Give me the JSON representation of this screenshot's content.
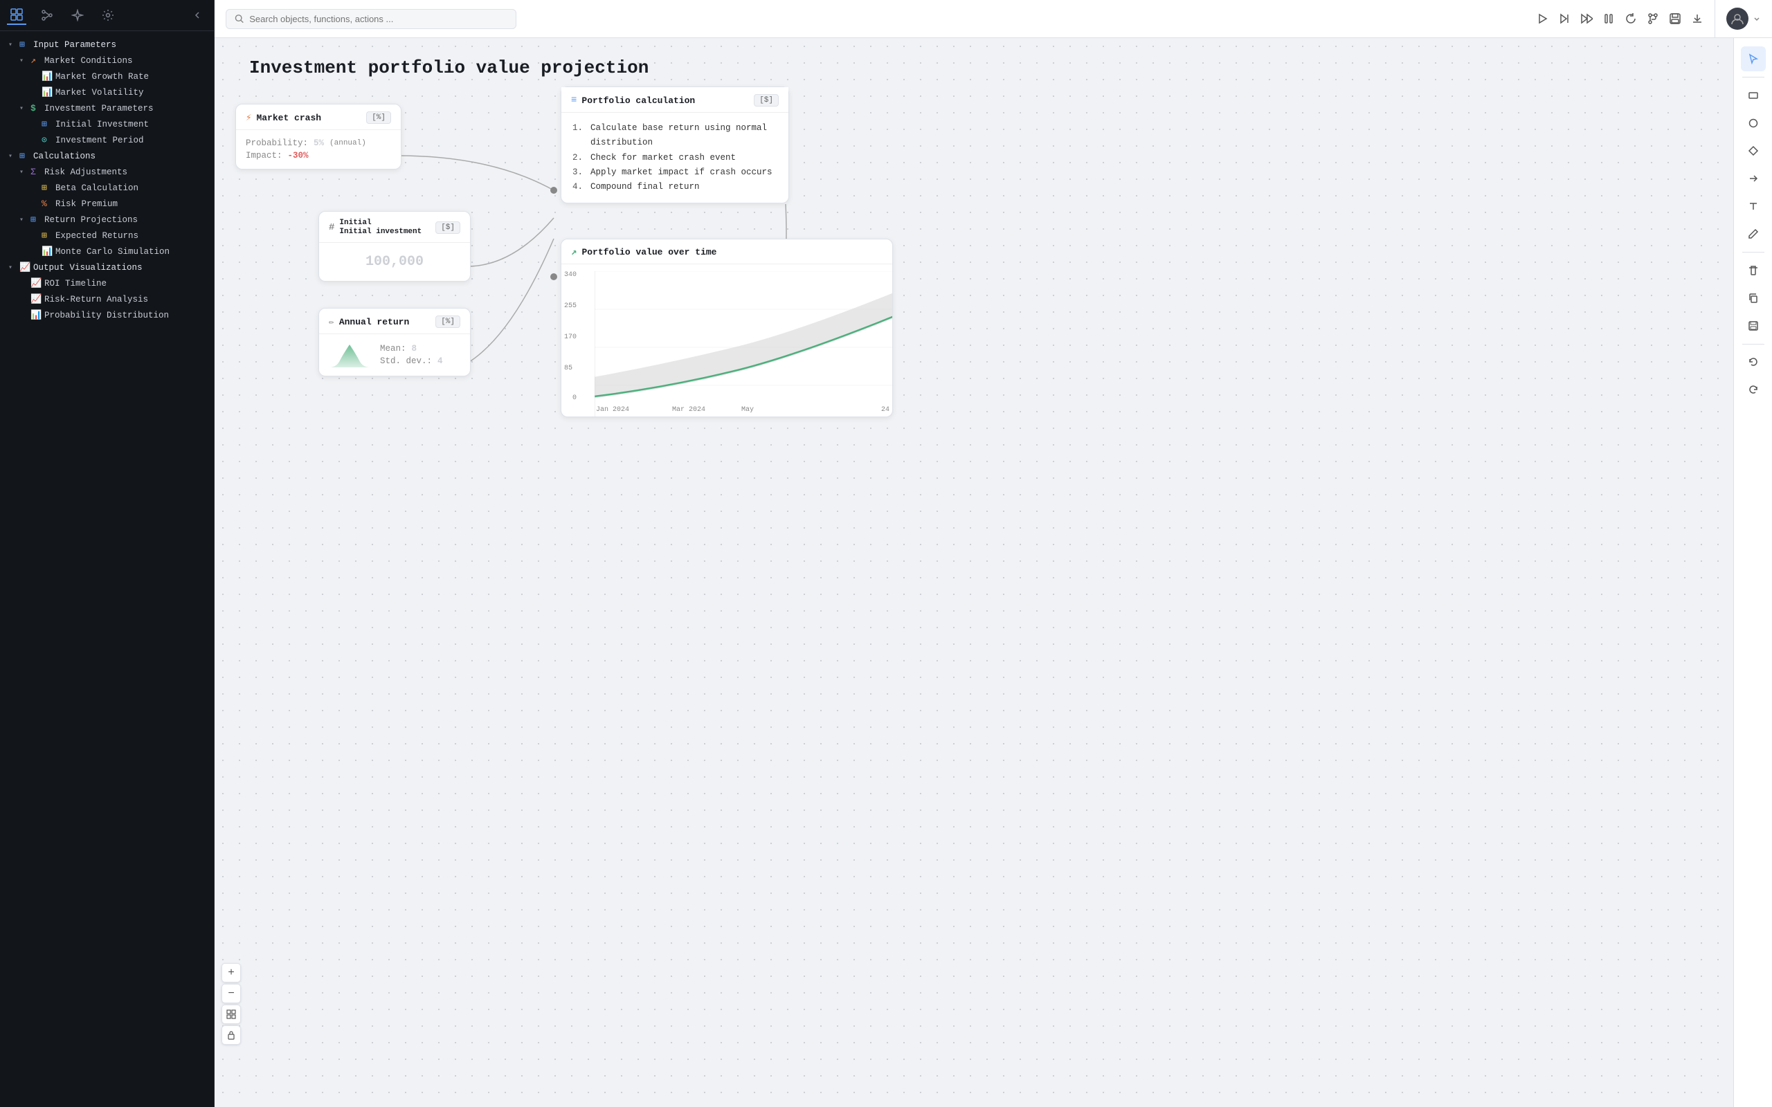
{
  "sidebar": {
    "top_icons": [
      "grid-icon",
      "git-icon",
      "sparkle-icon",
      "settings-icon"
    ],
    "tree": [
      {
        "id": "input-params",
        "label": "Input Parameters",
        "depth": 0,
        "icon": "⊞",
        "icon_color": "icon-blue",
        "expanded": true,
        "chevron": "▾"
      },
      {
        "id": "market-conditions",
        "label": "Market Conditions",
        "depth": 1,
        "icon": "↗",
        "icon_color": "icon-orange",
        "expanded": true,
        "chevron": "▾"
      },
      {
        "id": "market-growth-rate",
        "label": "Market Growth Rate",
        "depth": 2,
        "icon": "📊",
        "icon_color": "icon-red",
        "expanded": false,
        "chevron": ""
      },
      {
        "id": "market-volatility",
        "label": "Market Volatility",
        "depth": 2,
        "icon": "📊",
        "icon_color": "icon-red",
        "expanded": false,
        "chevron": ""
      },
      {
        "id": "investment-parameters",
        "label": "Investment Parameters",
        "depth": 1,
        "icon": "$",
        "icon_color": "icon-green",
        "expanded": true,
        "chevron": "▾"
      },
      {
        "id": "initial-investment",
        "label": "Initial Investment",
        "depth": 2,
        "icon": "⊞",
        "icon_color": "icon-blue",
        "expanded": false,
        "chevron": ""
      },
      {
        "id": "investment-period",
        "label": "Investment Period",
        "depth": 2,
        "icon": "⊙",
        "icon_color": "icon-teal",
        "expanded": false,
        "chevron": ""
      },
      {
        "id": "calculations",
        "label": "Calculations",
        "depth": 0,
        "icon": "⊞",
        "icon_color": "icon-blue",
        "expanded": true,
        "chevron": "▾"
      },
      {
        "id": "risk-adjustments",
        "label": "Risk Adjustments",
        "depth": 1,
        "icon": "Σ",
        "icon_color": "icon-purple",
        "expanded": true,
        "chevron": "▾"
      },
      {
        "id": "beta-calculation",
        "label": "Beta Calculation",
        "depth": 2,
        "icon": "⊞",
        "icon_color": "icon-yellow",
        "expanded": false,
        "chevron": ""
      },
      {
        "id": "risk-premium",
        "label": "Risk Premium",
        "depth": 2,
        "icon": "%",
        "icon_color": "icon-orange",
        "expanded": false,
        "chevron": ""
      },
      {
        "id": "return-projections",
        "label": "Return Projections",
        "depth": 1,
        "icon": "⊞",
        "icon_color": "icon-blue",
        "expanded": true,
        "chevron": "▾"
      },
      {
        "id": "expected-returns",
        "label": "Expected Returns",
        "depth": 2,
        "icon": "⊞",
        "icon_color": "icon-yellow",
        "expanded": false,
        "chevron": ""
      },
      {
        "id": "monte-carlo",
        "label": "Monte Carlo Simulation",
        "depth": 2,
        "icon": "📊",
        "icon_color": "icon-red",
        "expanded": false,
        "chevron": ""
      },
      {
        "id": "output-visualizations",
        "label": "Output Visualizations",
        "depth": 0,
        "icon": "📈",
        "icon_color": "icon-green",
        "expanded": true,
        "chevron": "▾"
      },
      {
        "id": "roi-timeline",
        "label": "ROI Timeline",
        "depth": 1,
        "icon": "📈",
        "icon_color": "icon-green",
        "expanded": false,
        "chevron": ""
      },
      {
        "id": "risk-return-analysis",
        "label": "Risk-Return Analysis",
        "depth": 1,
        "icon": "📈",
        "icon_color": "icon-green",
        "expanded": false,
        "chevron": ""
      },
      {
        "id": "probability-dist",
        "label": "Probability Distribution",
        "depth": 1,
        "icon": "📊",
        "icon_color": "icon-red",
        "expanded": false,
        "chevron": ""
      }
    ]
  },
  "toolbar": {
    "search_placeholder": "Search objects, functions, actions ...",
    "buttons": [
      "play",
      "play-next",
      "skip-forward",
      "pause",
      "refresh",
      "branch",
      "save",
      "download"
    ]
  },
  "canvas": {
    "title": "Investment portfolio value projection",
    "nodes": {
      "market_crash": {
        "title": "Market crash",
        "badge": "[%]",
        "icon": "⚡",
        "probability_label": "Probability:",
        "probability_value": "5%",
        "probability_suffix": "(annual)",
        "impact_label": "Impact:",
        "impact_value": "-30%"
      },
      "initial_investment": {
        "title": "Initial investment",
        "badge": "[$]",
        "icon": "#",
        "value": "100,000"
      },
      "annual_return": {
        "title": "Annual return",
        "badge": "[%]",
        "icon": "✏",
        "mean_label": "Mean:",
        "mean_value": "8",
        "std_label": "Std. dev.:",
        "std_value": "4"
      },
      "portfolio_calc": {
        "title": "Portfolio calculation",
        "badge": "[$]",
        "icon": "≡",
        "steps": [
          "Calculate base return using normal distribution",
          "Check for market crash event",
          "Apply market impact if crash occurs",
          "Compound final return"
        ]
      },
      "portfolio_chart": {
        "title": "Portfolio value over time",
        "icon": "↗",
        "y_labels": [
          "340",
          "255",
          "170",
          "85",
          "0"
        ],
        "x_labels": [
          "Jan 2024",
          "Mar 2024",
          "May",
          "24"
        ]
      }
    }
  },
  "right_panel": {
    "tools": [
      "cursor",
      "rectangle",
      "circle",
      "diamond",
      "arrow",
      "text",
      "pen",
      "trash",
      "copy",
      "save",
      "undo",
      "redo"
    ]
  }
}
